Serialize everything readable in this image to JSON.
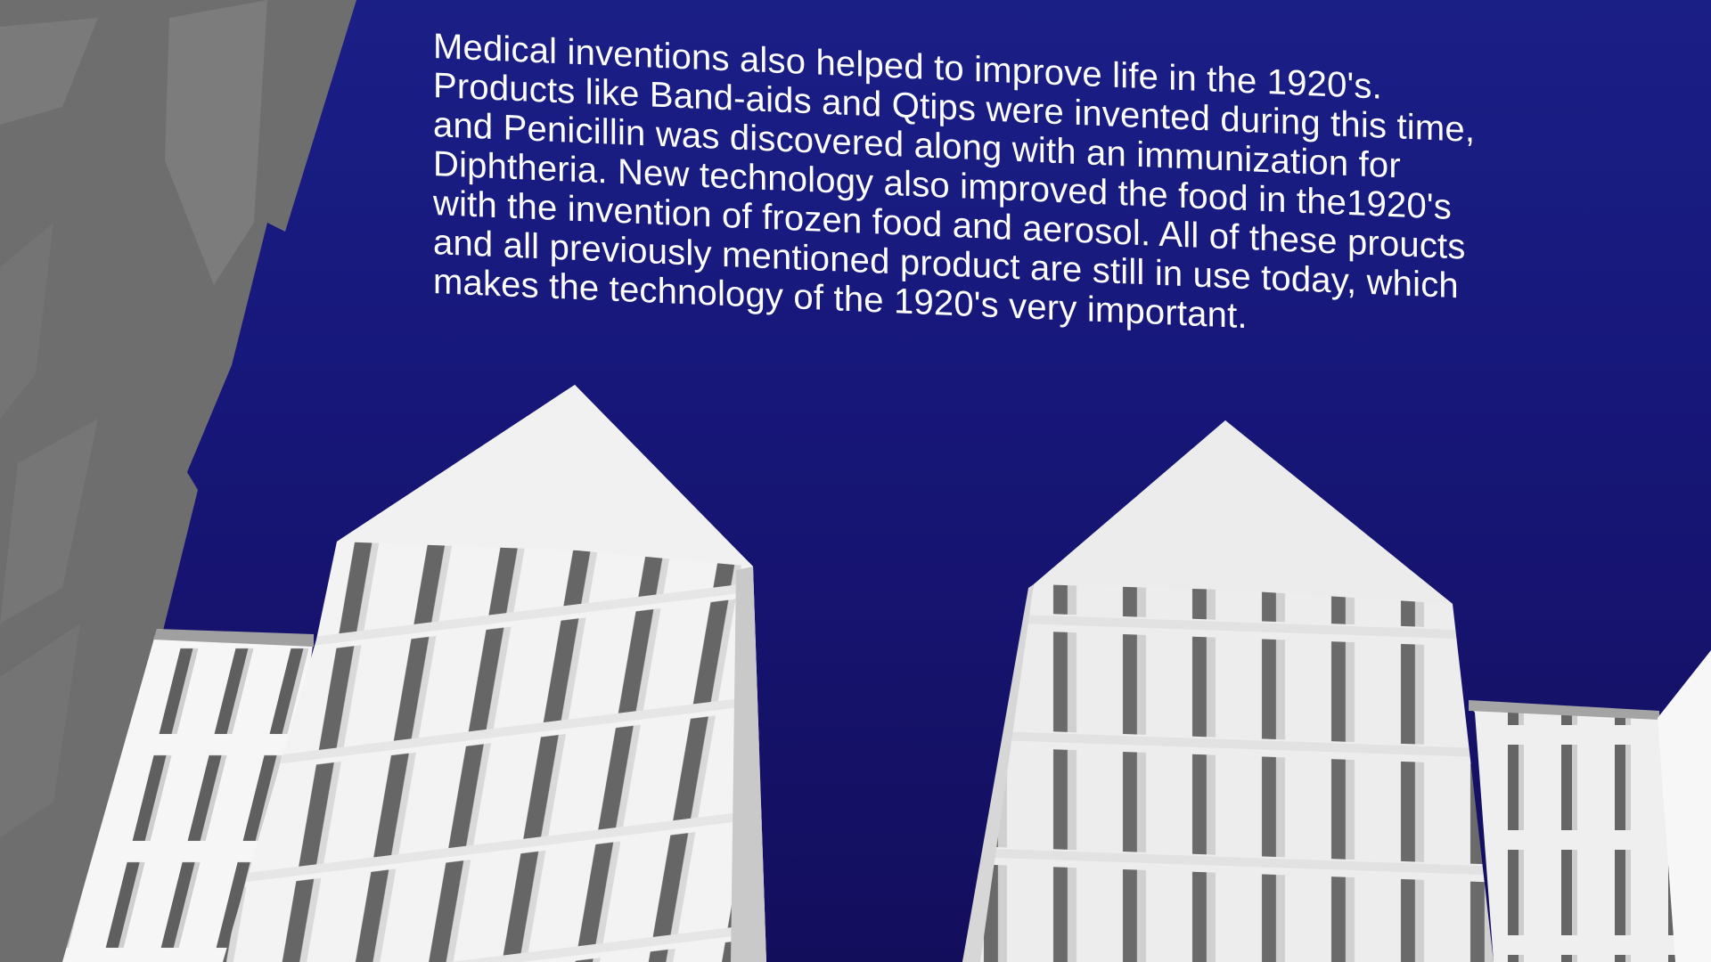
{
  "slide": {
    "caption_lines": [
      "Medical inventions also helped to improve life in the 1920's.",
      "Products like Band-aids and Qtips were invented during this time,",
      "and Penicillin was discovered along with an immunization for",
      "Diphtheria.  New technology also improved the food in the1920's",
      "with the invention of frozen food and aerosol.  All of these proucts",
      "and all previously mentioned product are still in use today, which",
      "makes the technology of the 1920's very important."
    ]
  },
  "colors": {
    "sky_top": "#1a1f86",
    "sky_bottom": "#130e5c",
    "building_white": "#f4f4f4",
    "building_shadow": "#8a8a8a",
    "foreground_gray": "#7a7a7a",
    "text": "#ffffff"
  }
}
